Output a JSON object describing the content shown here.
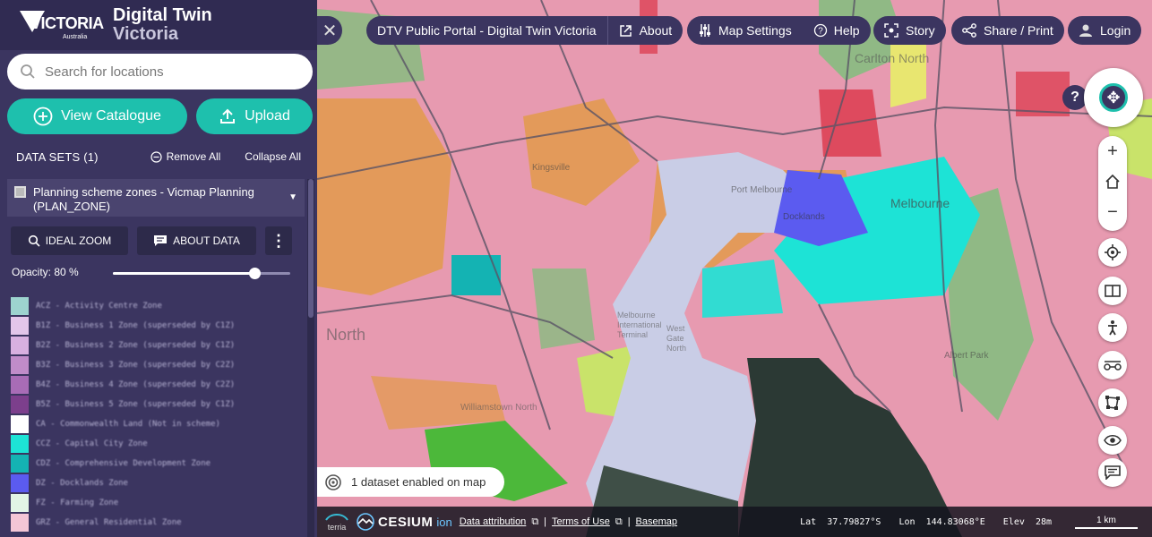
{
  "brand": {
    "logo_text": "VICTORIA",
    "logo_sub": "Australia",
    "title_line1": "Digital Twin",
    "title_line2": "Victoria"
  },
  "search": {
    "placeholder": "Search for locations"
  },
  "buttons": {
    "catalogue": "View Catalogue",
    "upload": "Upload"
  },
  "datasets": {
    "header": "DATA SETS (1)",
    "remove_all": "Remove All",
    "collapse_all": "Collapse All",
    "item": {
      "name": "Planning scheme zones - Vicmap Planning (PLAN_ZONE)",
      "ideal_zoom": "IDEAL ZOOM",
      "about_data": "ABOUT DATA",
      "opacity_label": "Opacity: 80 %",
      "opacity": 0.8,
      "legend": [
        {
          "label": "ACZ - Activity Centre Zone",
          "color": "#9dd3cf"
        },
        {
          "label": "B1Z - Business 1 Zone (superseded by C1Z)",
          "color": "#e3c6ea"
        },
        {
          "label": "B2Z - Business 2 Zone (superseded by C1Z)",
          "color": "#d8b0e0"
        },
        {
          "label": "B3Z - Business 3 Zone (superseded by C2Z)",
          "color": "#c08cc9"
        },
        {
          "label": "B4Z - Business 4 Zone (superseded by C2Z)",
          "color": "#a86cb6"
        },
        {
          "label": "B5Z - Business 5 Zone (superseded by C1Z)",
          "color": "#7c3f8c"
        },
        {
          "label": "CA - Commonwealth Land (Not in scheme)",
          "color": "#ffffff"
        },
        {
          "label": "CCZ - Capital City Zone",
          "color": "#1de3d6"
        },
        {
          "label": "CDZ - Comprehensive Development Zone",
          "color": "#14b3b3"
        },
        {
          "label": "DZ - Docklands Zone",
          "color": "#5b5bf0"
        },
        {
          "label": "FZ - Farming Zone",
          "color": "#e2f5e6"
        },
        {
          "label": "GRZ - General Residential Zone",
          "color": "#f4c6d6"
        }
      ]
    }
  },
  "topbar": {
    "portal": "DTV Public Portal - Digital Twin Victoria",
    "about": "About",
    "map_settings": "Map Settings",
    "help": "Help",
    "story": "Story",
    "share": "Share / Print",
    "login": "Login"
  },
  "map_labels": {
    "carlton": "Carlton North",
    "melbourne": "Melbourne",
    "docklands": "Docklands",
    "port_melbourne": "Port Melbourne",
    "north": "North",
    "kingsville": "Kingsville",
    "mt": "Melbourne",
    "mt2": "International",
    "mt3": "Terminal",
    "wd": "West",
    "wd2": "Gate",
    "wd3": "North",
    "williamstown": "Williamstown North",
    "albert": "Albert Park"
  },
  "status": {
    "datasets_enabled": "1 dataset enabled on map"
  },
  "footer": {
    "terria": "terria",
    "cesium": "CESIUM",
    "ion": "ion",
    "data_attribution": "Data attribution",
    "terms": "Terms of Use",
    "basemap": "Basemap",
    "lat_label": "Lat",
    "lat": "37.79827°S",
    "lon_label": "Lon",
    "lon": "144.83068°E",
    "elev_label": "Elev",
    "elev": "28m",
    "scale": "1 km"
  },
  "colors": {
    "sidebar": "#3b3560",
    "accent": "#1ec0ad",
    "map_residential": "#e79ab0",
    "map_industrial": "#e39a5a",
    "map_park": "#7bc07a",
    "map_ccz": "#1de3d6",
    "map_docklands": "#5b5bf0",
    "map_port": "#c9cde6"
  }
}
